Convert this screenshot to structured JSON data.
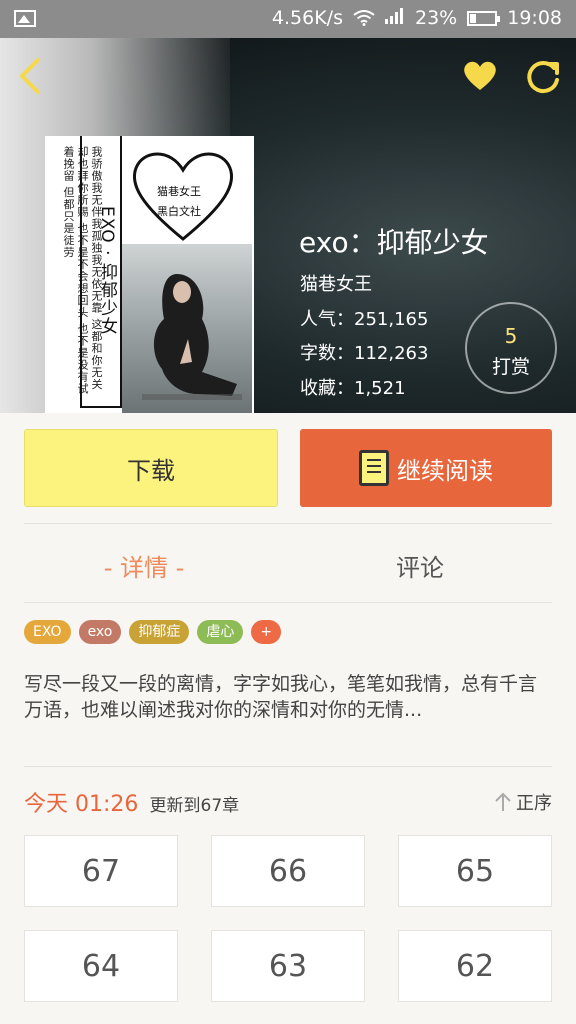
{
  "status_bar": {
    "speed": "4.56K/s",
    "battery": "23%",
    "time": "19:08",
    "battery_level": 0.23
  },
  "header": {
    "icons": [
      "back-icon",
      "heart-icon",
      "refresh-icon"
    ]
  },
  "cover": {
    "title": "EXO · 抑郁少女",
    "publisher_line1": "猫巷女王",
    "publisher_line2": "黑白文社",
    "side_text": "我骄傲我无伴我孤独我无依无靠 这都和你无关却也拜你所赐 也不是不会想回头 也不是没有试着挽留 但都只是徒劳"
  },
  "book": {
    "title": "exo：抑郁少女",
    "author": "猫巷女王",
    "popularity_label": "人气：",
    "popularity": "251,165",
    "words_label": "字数：",
    "words": "112,263",
    "favorites_label": "收藏：",
    "favorites": "1,521"
  },
  "tip": {
    "count": "5",
    "label": "打赏"
  },
  "actions": {
    "download": "下载",
    "continue_reading": "继续阅读"
  },
  "tabs": {
    "detail": "- 详情 -",
    "comment": "评论"
  },
  "tags": [
    {
      "label": "EXO",
      "color": "#e4a73a"
    },
    {
      "label": "exo",
      "color": "#c27a66"
    },
    {
      "label": "抑郁症",
      "color": "#c9a236"
    },
    {
      "label": "虐心",
      "color": "#8dbb55"
    },
    {
      "label": "+",
      "color": "#ee6a44"
    }
  ],
  "description": "写尽一段又一段的离情，字字如我心，笔笔如我情，总有千言万语，也难以阐述我对你的深情和对你的无情...",
  "update": {
    "today": "今天 01:26",
    "text": "更新到67章"
  },
  "sort": {
    "label": "正序"
  },
  "chapters": [
    "67",
    "66",
    "65",
    "64",
    "63",
    "62"
  ],
  "colors": {
    "accent": "#e8663c",
    "download_bg": "#fcf27e",
    "tab_active": "#ee8a5c"
  }
}
